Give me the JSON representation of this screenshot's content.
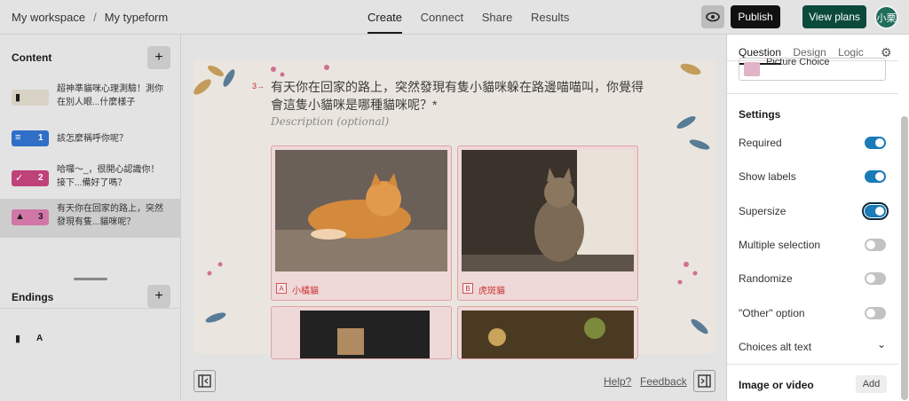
{
  "topbar": {
    "workspace": "My workspace",
    "separator": "/",
    "form_name": "My typeform",
    "nav": [
      "Create",
      "Connect",
      "Share",
      "Results"
    ],
    "publish": "Publish",
    "view_plans": "View plans",
    "avatar": "小栗"
  },
  "left": {
    "content_title": "Content",
    "questions": [
      {
        "num": "",
        "glyph": "▮",
        "text": "超神準貓咪心理測驗！測你在別人眼...什麼樣子",
        "color": "#d8d2c4"
      },
      {
        "num": "1",
        "glyph": "≡",
        "text": "該怎麼稱呼你呢？",
        "color": "#2f6fc7"
      },
      {
        "num": "2",
        "glyph": "✓",
        "text": "哈囉～_，很開心認識你！接下...備好了嗎？",
        "color": "#c0427a"
      },
      {
        "num": "3",
        "glyph": "▲",
        "text": "有天你在回家的路上，突然發現有隻...貓咪呢？",
        "color": "#d177a8"
      }
    ],
    "endings_title": "Endings",
    "ending_item": "A"
  },
  "canvas": {
    "qnum": "3→",
    "title": "有天你在回家的路上，突然發現有隻小貓咪躲在路邊喵喵叫，你覺得會這隻小貓咪是哪種貓咪呢？*",
    "description": "Description (optional)",
    "choices": [
      {
        "key": "A",
        "label": "小橘貓"
      },
      {
        "key": "B",
        "label": "虎斑貓"
      }
    ],
    "help": "Help?",
    "feedback": "Feedback"
  },
  "right": {
    "tabs": [
      "Question",
      "Design",
      "Logic"
    ],
    "qtype": "Picture Choice",
    "settings_title": "Settings",
    "settings": [
      {
        "label": "Required",
        "on": true
      },
      {
        "label": "Show labels",
        "on": true
      },
      {
        "label": "Supersize",
        "on": true
      },
      {
        "label": "Multiple selection",
        "on": false
      },
      {
        "label": "Randomize",
        "on": false
      },
      {
        "label": "\"Other\" option",
        "on": false
      }
    ],
    "alt_text": "Choices alt text",
    "image_title": "Image or video",
    "add": "Add"
  }
}
